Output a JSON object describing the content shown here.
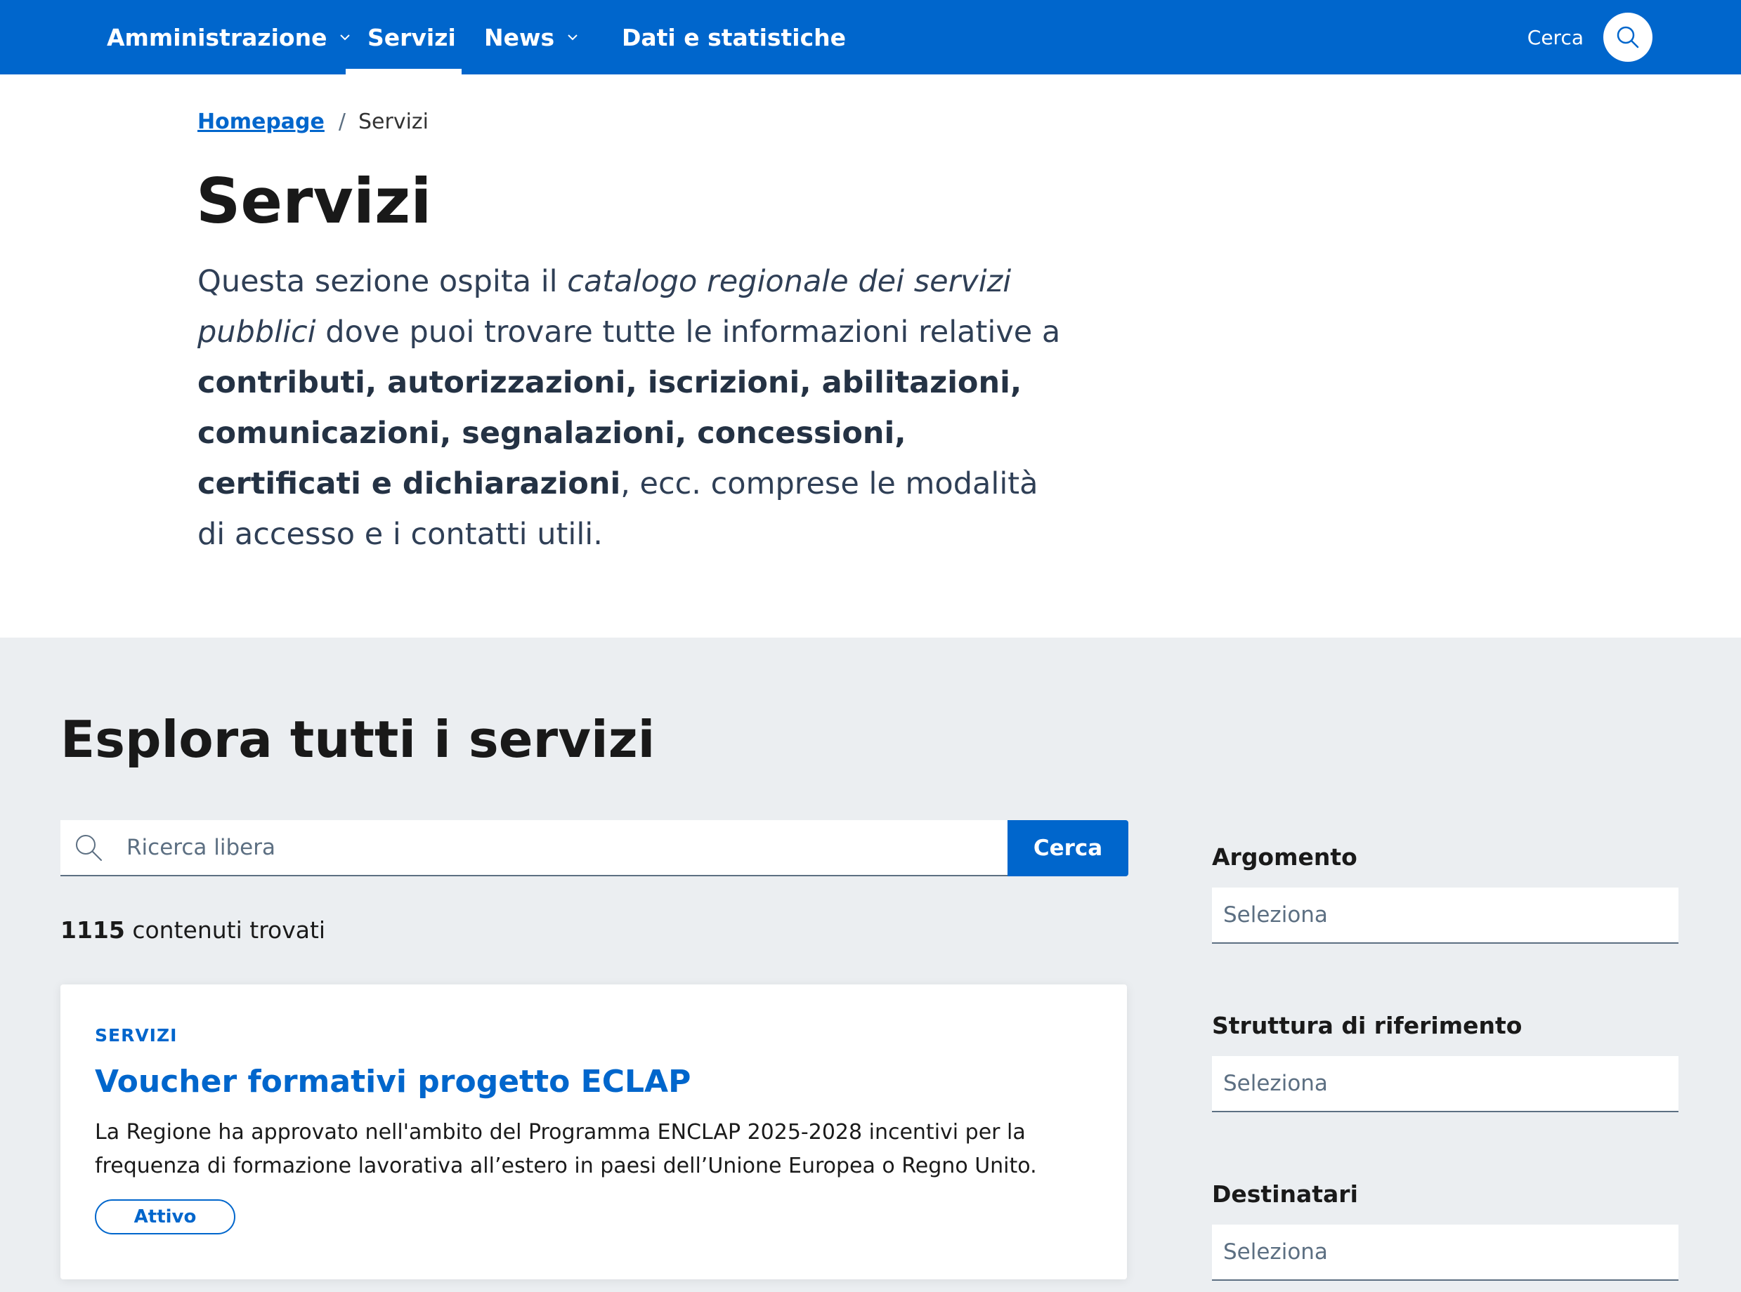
{
  "nav": {
    "items": [
      {
        "label": "Amministrazione",
        "has_dropdown": true
      },
      {
        "label": "Servizi",
        "has_dropdown": false,
        "active": true
      },
      {
        "label": "News",
        "has_dropdown": true
      },
      {
        "label": "Dati e statistiche",
        "has_dropdown": false
      }
    ],
    "search_label": "Cerca"
  },
  "breadcrumb": {
    "home": "Homepage",
    "separator": "/",
    "current": "Servizi"
  },
  "hero": {
    "title": "Servizi",
    "lead_part1": "Questa sezione ospita il ",
    "lead_italic": "catalogo regionale dei servizi pubblici",
    "lead_part2": " dove puoi trovare tutte le informazioni relative a ",
    "lead_bold": "contributi, autorizzazioni, iscrizioni, abilitazioni, comunicazioni, segnalazioni, concessioni, certificati e dichiarazioni",
    "lead_part3": ", ecc. comprese le modalità di accesso e i contatti utili."
  },
  "explore": {
    "title": "Esplora tutti i servizi",
    "search_placeholder": "Ricerca libera",
    "search_value": "",
    "search_button": "Cerca",
    "results_count": "1115",
    "results_label": " contenuti trovati"
  },
  "results": [
    {
      "category": "SERVIZI",
      "title": "Voucher formativi progetto ECLAP",
      "description": "La Regione ha approvato nell'ambito del Programma ENCLAP 2025-2028 incentivi per la frequenza di formazione lavorativa all’estero in paesi dell’Unione Europea o Regno Unito.",
      "status": "Attivo"
    }
  ],
  "filters": [
    {
      "label": "Argomento",
      "value": "Seleziona"
    },
    {
      "label": "Struttura di riferimento",
      "value": "Seleziona"
    },
    {
      "label": "Destinatari",
      "value": "Seleziona"
    }
  ],
  "colors": {
    "primary": "#0066cc",
    "section_bg": "#ebeef1",
    "text_dark": "#1a1a1a",
    "muted": "#5c6f82"
  },
  "icons": {
    "dropdown": "chevron-down-icon",
    "search": "search-icon"
  }
}
